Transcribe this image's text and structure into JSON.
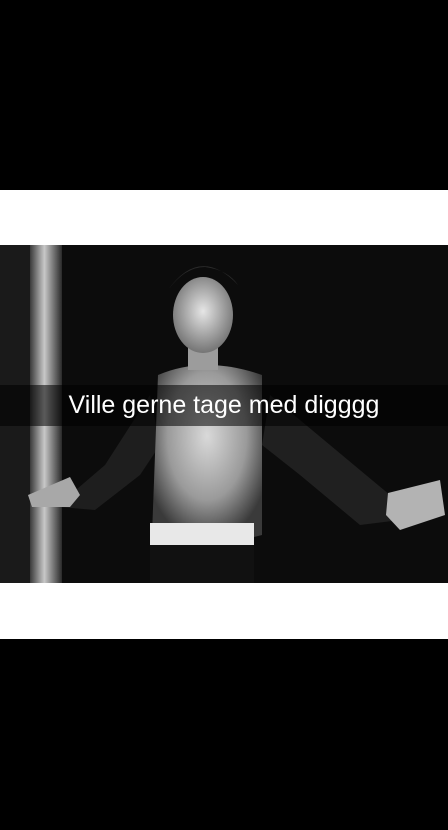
{
  "snap": {
    "caption": "Ville gerne tage med digggg",
    "colors": {
      "background": "#000000",
      "band": "#ffffff",
      "caption_bar": "#000000",
      "caption_text": "#ffffff"
    }
  }
}
